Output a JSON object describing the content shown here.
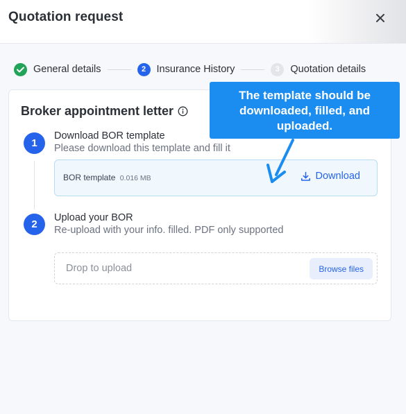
{
  "header": {
    "title": "Quotation request",
    "close_icon": "close-icon"
  },
  "stepper": {
    "steps": [
      {
        "label": "General details",
        "state": "done",
        "marker": ""
      },
      {
        "label": "Insurance History",
        "state": "active",
        "marker": "2"
      },
      {
        "label": "Quotation details",
        "state": "todo",
        "marker": "3"
      }
    ]
  },
  "card": {
    "title": "Broker appointment letter",
    "info_icon": "info-icon",
    "step1": {
      "number": "1",
      "heading": "Download BOR template",
      "description": "Please download this template and fill it",
      "file": {
        "name": "BOR template",
        "size": "0.016 MB"
      },
      "download_label": "Download"
    },
    "step2": {
      "number": "2",
      "heading": "Upload your BOR",
      "description": "Re-upload with your info. filled. PDF only supported",
      "drop_placeholder": "Drop to upload",
      "browse_label": "Browse files"
    }
  },
  "callout": {
    "text": "The template should be downloaded, filled, and uploaded."
  },
  "colors": {
    "accent": "#2563eb",
    "success": "#22a35a",
    "callout": "#1b8cf0"
  }
}
